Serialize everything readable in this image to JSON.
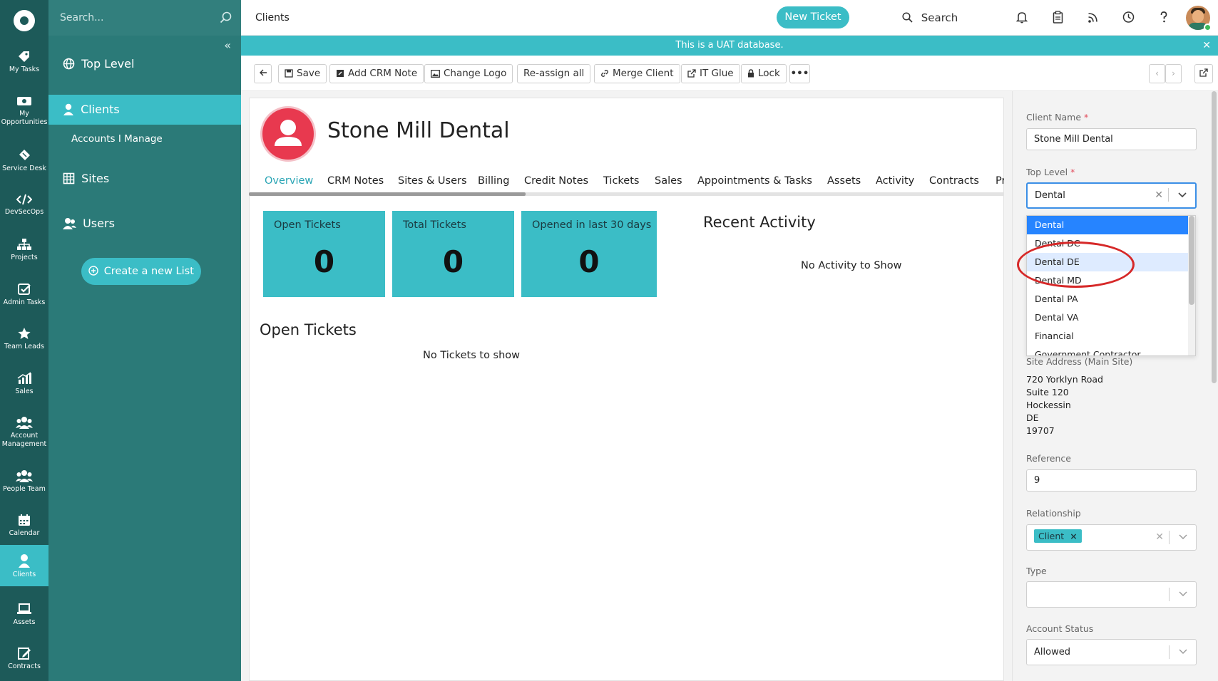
{
  "header": {
    "page_title": "Clients",
    "new_ticket": "New Ticket",
    "search": "Search"
  },
  "banner": "This is a UAT database.",
  "rail": [
    {
      "label": "My Tasks",
      "icon": "tag-icon"
    },
    {
      "label": "My Opportunities",
      "icon": "money-icon"
    },
    {
      "label": "Service Desk",
      "icon": "ticket-icon"
    },
    {
      "label": "DevSecOps",
      "icon": "code-icon"
    },
    {
      "label": "Projects",
      "icon": "sitemap-icon"
    },
    {
      "label": "Admin Tasks",
      "icon": "checkbox-icon"
    },
    {
      "label": "Team Leads",
      "icon": "star-icon"
    },
    {
      "label": "Sales",
      "icon": "chart-icon"
    },
    {
      "label": "Account Management",
      "icon": "users-icon"
    },
    {
      "label": "People Team",
      "icon": "users-icon"
    },
    {
      "label": "Calendar",
      "icon": "calendar-icon"
    },
    {
      "label": "Clients",
      "icon": "user-icon",
      "active": true
    },
    {
      "label": "Assets",
      "icon": "laptop-icon"
    },
    {
      "label": "Contracts",
      "icon": "edit-icon"
    }
  ],
  "sidebar": {
    "search_placeholder": "Search...",
    "top_level": "Top Level",
    "clients": "Clients",
    "accounts_i_manage": "Accounts I Manage",
    "sites": "Sites",
    "users": "Users",
    "create_list": "Create a new List"
  },
  "toolbar": {
    "save": "Save",
    "add_crm_note": "Add CRM Note",
    "change_logo": "Change Logo",
    "reassign_all": "Re-assign all",
    "merge_client": "Merge Client",
    "it_glue": "IT Glue",
    "lock": "Lock"
  },
  "client": {
    "name": "Stone Mill Dental"
  },
  "tabs": [
    "Overview",
    "CRM Notes",
    "Sites & Users",
    "Billing",
    "Credit Notes",
    "Tickets",
    "Sales",
    "Appointments & Tasks",
    "Assets",
    "Activity",
    "Contracts",
    "Pr"
  ],
  "stats": [
    {
      "label": "Open Tickets",
      "value": "0"
    },
    {
      "label": "Total Tickets",
      "value": "0"
    },
    {
      "label": "Opened in last 30 days",
      "value": "0"
    }
  ],
  "recent_activity": {
    "title": "Recent Activity",
    "empty": "No Activity to Show"
  },
  "open_tickets": {
    "title": "Open Tickets",
    "empty": "No Tickets to show"
  },
  "form": {
    "client_name_label": "Client Name",
    "client_name_value": "Stone Mill Dental",
    "top_level_label": "Top Level",
    "top_level_value": "Dental",
    "top_level_options": [
      "Dental",
      "Dental DC",
      "Dental DE",
      "Dental MD",
      "Dental PA",
      "Dental VA",
      "Financial",
      "Government Contractor"
    ],
    "site_address_label": "Site Address (Main Site)",
    "address_lines": [
      "720 Yorklyn Road",
      "Suite 120",
      "Hockessin",
      "DE",
      "19707"
    ],
    "reference_label": "Reference",
    "reference_value": "9",
    "relationship_label": "Relationship",
    "relationship_tag": "Client",
    "type_label": "Type",
    "type_value": "",
    "account_status_label": "Account Status",
    "account_status_value": "Allowed",
    "required_mark": "*"
  },
  "colors": {
    "rail_bg": "#1d5a59",
    "sidebar_bg": "#2b7a78",
    "accent": "#3bbdc6",
    "client_avatar": "#e8394f",
    "annotation_circle": "#d62828"
  }
}
